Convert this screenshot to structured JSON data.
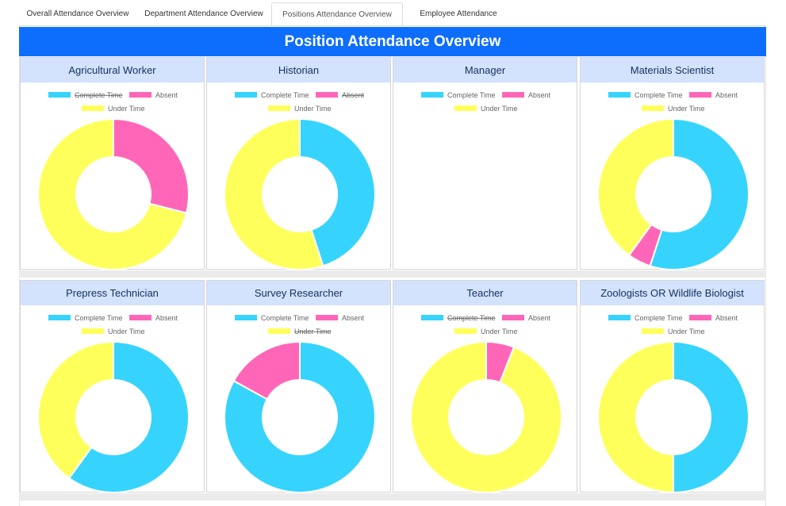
{
  "tabs": [
    {
      "label": "Overall Attendance Overview",
      "active": false
    },
    {
      "label": "Department Attendance Overview",
      "active": false
    },
    {
      "label": "Positions Attendance Overview",
      "active": true
    },
    {
      "label": "Employee Attendance Overview",
      "active": false
    }
  ],
  "page": {
    "title": "Position Attendance Overview"
  },
  "colors": {
    "complete_time": "#36d4fc",
    "absent": "#ff66b8",
    "under_time": "#ffff5c",
    "title_bar": "#0d6efd",
    "card_header": "#d3e2fd"
  },
  "chart_data": [
    {
      "type": "doughnut",
      "title": "Agricultural Worker",
      "categories": [
        "Complete Time",
        "Absent",
        "Under Time"
      ],
      "values": [
        0,
        29,
        71
      ],
      "hidden": [
        "Complete Time"
      ]
    },
    {
      "type": "doughnut",
      "title": "Historian",
      "categories": [
        "Complete Time",
        "Absent",
        "Under Time"
      ],
      "values": [
        45,
        0,
        55
      ],
      "hidden": [
        "Absent"
      ]
    },
    {
      "type": "doughnut",
      "title": "Manager",
      "categories": [
        "Complete Time",
        "Absent",
        "Under Time"
      ],
      "values": [
        0,
        0,
        0
      ],
      "hidden": []
    },
    {
      "type": "doughnut",
      "title": "Materials Scientist",
      "categories": [
        "Complete Time",
        "Absent",
        "Under Time"
      ],
      "values": [
        55,
        5,
        40
      ],
      "hidden": []
    },
    {
      "type": "doughnut",
      "title": "Prepress Technician",
      "categories": [
        "Complete Time",
        "Absent",
        "Under Time"
      ],
      "values": [
        60,
        0,
        40
      ],
      "hidden": []
    },
    {
      "type": "doughnut",
      "title": "Survey Researcher",
      "categories": [
        "Complete Time",
        "Absent",
        "Under Time"
      ],
      "values": [
        83,
        17,
        0
      ],
      "hidden": [
        "Under Time"
      ]
    },
    {
      "type": "doughnut",
      "title": "Teacher",
      "categories": [
        "Complete Time",
        "Absent",
        "Under Time"
      ],
      "values": [
        0,
        6,
        94
      ],
      "hidden": [
        "Complete Time"
      ]
    },
    {
      "type": "doughnut",
      "title": "Zoologists OR Wildlife Biologist",
      "categories": [
        "Complete Time",
        "Absent",
        "Under Time"
      ],
      "values": [
        50,
        0,
        50
      ],
      "hidden": []
    }
  ]
}
